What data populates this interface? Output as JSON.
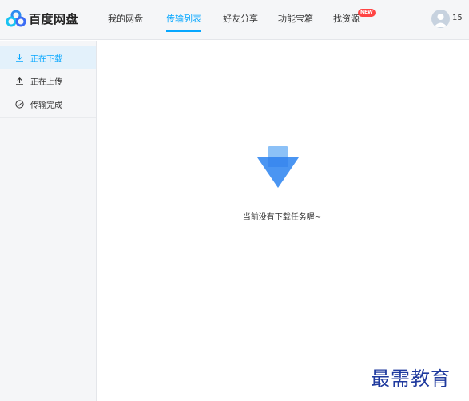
{
  "app": {
    "brand": "百度网盘"
  },
  "nav": {
    "items": [
      "我的网盘",
      "传输列表",
      "好友分享",
      "功能宝箱",
      "找资源"
    ],
    "active_index": 1,
    "badge": "NEW"
  },
  "user": {
    "name_fragment": "15"
  },
  "sidebar": {
    "items": [
      {
        "label": "正在下载",
        "icon": "download-icon",
        "active": true
      },
      {
        "label": "正在上传",
        "icon": "upload-icon",
        "active": false
      },
      {
        "label": "传输完成",
        "icon": "check-circle-icon",
        "active": false
      }
    ]
  },
  "main": {
    "empty_message": "当前没有下载任务喔~"
  },
  "watermark": {
    "text": "最需教育"
  },
  "colors": {
    "accent": "#06a7ff",
    "sidebar_bg": "#f5f6f8",
    "active_bg": "#e3f1fb",
    "badge": "#ff4444"
  }
}
